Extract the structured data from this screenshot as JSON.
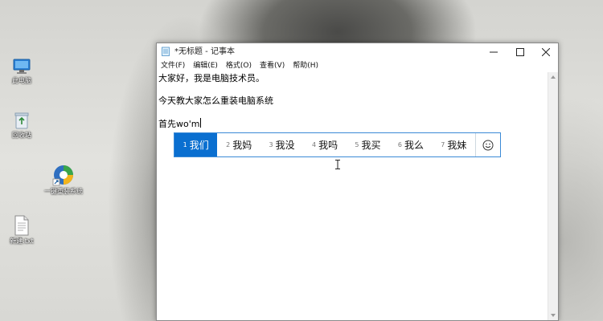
{
  "window": {
    "title": "*无标题 - 记事本",
    "controls": {
      "minimize": "minimize-icon",
      "maximize": "maximize-icon",
      "close": "close-icon"
    }
  },
  "menu": {
    "items": [
      {
        "label": "文件(F)"
      },
      {
        "label": "编辑(E)"
      },
      {
        "label": "格式(O)"
      },
      {
        "label": "查看(V)"
      },
      {
        "label": "帮助(H)"
      }
    ]
  },
  "editor": {
    "lines": [
      "大家好，我是电脑技术员。",
      "今天教大家怎么重装电脑系统",
      "首先wo'm"
    ]
  },
  "ime": {
    "selected_index": 0,
    "candidates": [
      {
        "num": "1",
        "text": "我们"
      },
      {
        "num": "2",
        "text": "我妈"
      },
      {
        "num": "3",
        "text": "我没"
      },
      {
        "num": "4",
        "text": "我吗"
      },
      {
        "num": "5",
        "text": "我买"
      },
      {
        "num": "6",
        "text": "我么"
      },
      {
        "num": "7",
        "text": "我妹"
      }
    ],
    "emoji_icon": "smiley-icon",
    "accent_color": "#0a6fd0"
  },
  "desktop": {
    "icons": [
      {
        "name": "computer-icon",
        "label": "此电脑"
      },
      {
        "name": "recycle-bin-icon",
        "label": "回收站"
      },
      {
        "name": "app-shortcut-icon",
        "label": "一键重装系统"
      },
      {
        "name": "text-file-icon",
        "label": "新建.txt"
      }
    ]
  }
}
